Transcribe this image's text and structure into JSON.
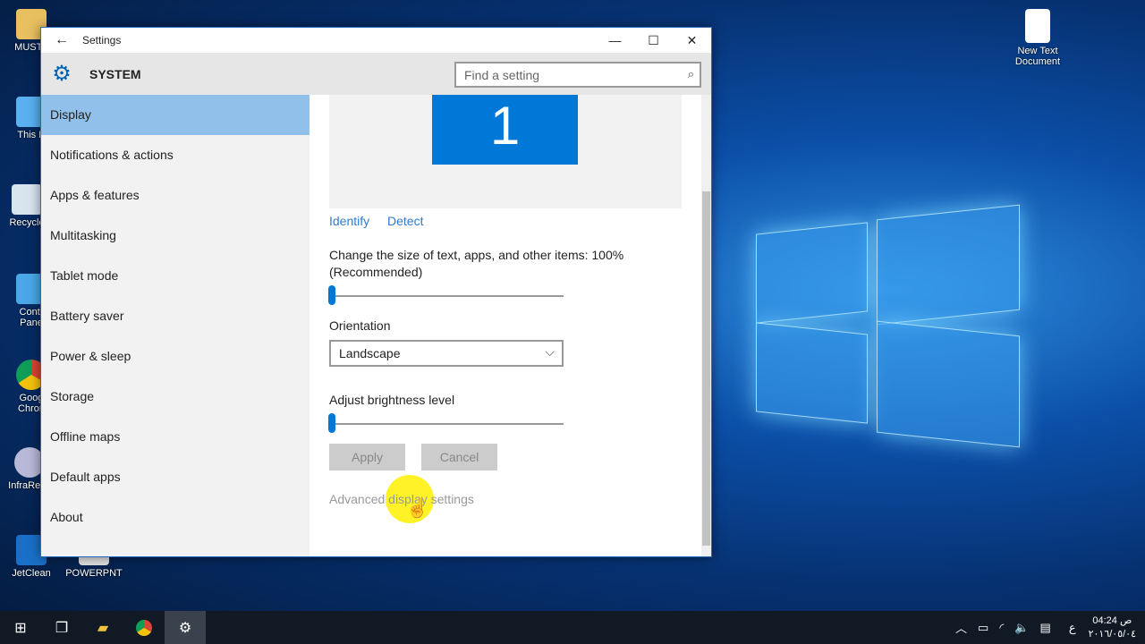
{
  "desktop": {
    "icons": [
      {
        "label": "MUSTA",
        "icon": "user-folder-icon"
      },
      {
        "label": "This P",
        "icon": "this-pc-icon"
      },
      {
        "label": "Recycle",
        "icon": "recycle-bin-icon"
      },
      {
        "label": "Contr\nPane",
        "icon": "control-panel-icon"
      },
      {
        "label": "Goog\nChron",
        "icon": "chrome-icon"
      },
      {
        "label": "InfraReco",
        "icon": "infrarecorder-icon"
      },
      {
        "label": "JetClean",
        "icon": "jetclean-icon"
      },
      {
        "label": "POWERPNT",
        "icon": "powerpoint-icon"
      },
      {
        "label": "New Text Document",
        "icon": "text-file-icon"
      }
    ]
  },
  "window": {
    "title": "Settings",
    "section": "SYSTEM",
    "search_placeholder": "Find a setting"
  },
  "sidebar": {
    "items": [
      {
        "label": "Display",
        "selected": true
      },
      {
        "label": "Notifications & actions"
      },
      {
        "label": "Apps & features"
      },
      {
        "label": "Multitasking"
      },
      {
        "label": "Tablet mode"
      },
      {
        "label": "Battery saver"
      },
      {
        "label": "Power & sleep"
      },
      {
        "label": "Storage"
      },
      {
        "label": "Offline maps"
      },
      {
        "label": "Default apps"
      },
      {
        "label": "About"
      }
    ]
  },
  "display": {
    "monitor_number": "1",
    "identify": "Identify",
    "detect": "Detect",
    "size_label": "Change the size of text, apps, and other items: 100%",
    "size_label2": "(Recommended)",
    "size_value": 100,
    "orientation_label": "Orientation",
    "orientation_value": "Landscape",
    "brightness_label": "Adjust brightness level",
    "brightness_value": 0,
    "apply": "Apply",
    "cancel": "Cancel",
    "advanced": "Advanced display settings",
    "accent": "#0078d7"
  },
  "taskbar": {
    "language": "ع",
    "time": "04:24 ص",
    "date": "٢٠١٦/٠٥/٠٤"
  }
}
